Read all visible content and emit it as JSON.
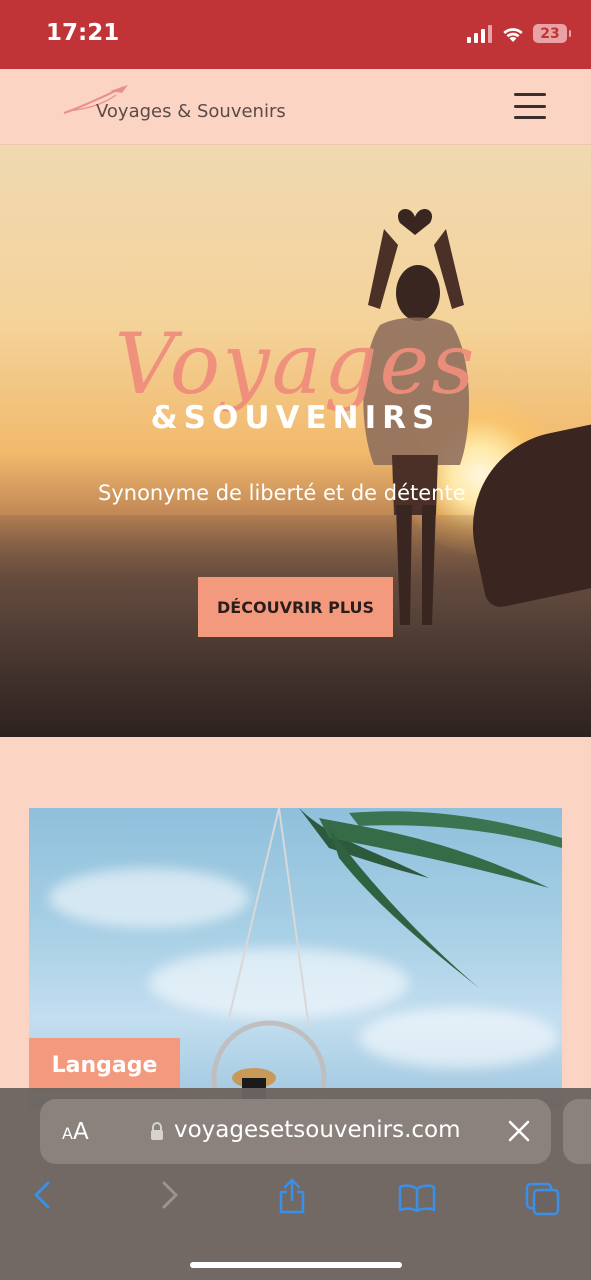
{
  "status_bar": {
    "time": "17:21",
    "battery": "23",
    "bg_color": "#c03438"
  },
  "header": {
    "logo_text": "Voyages & Souvenirs",
    "menu_icon": "hamburger-icon"
  },
  "hero": {
    "title_script": "Voyages",
    "title_caps": "&SOUVENIRS",
    "tagline": "Synonyme de liberté et de détente",
    "cta_label": "DÉCOUVRIR PLUS",
    "accent_color": "#f39a7e"
  },
  "floating": {
    "language_label": "Langage"
  },
  "browser": {
    "text_size_label_small": "A",
    "text_size_label_big": "A",
    "url": "voyagesetsouvenirs.com",
    "icons": [
      "back-icon",
      "forward-icon",
      "share-icon",
      "bookmarks-icon",
      "tabs-icon",
      "lock-icon",
      "close-icon"
    ]
  }
}
